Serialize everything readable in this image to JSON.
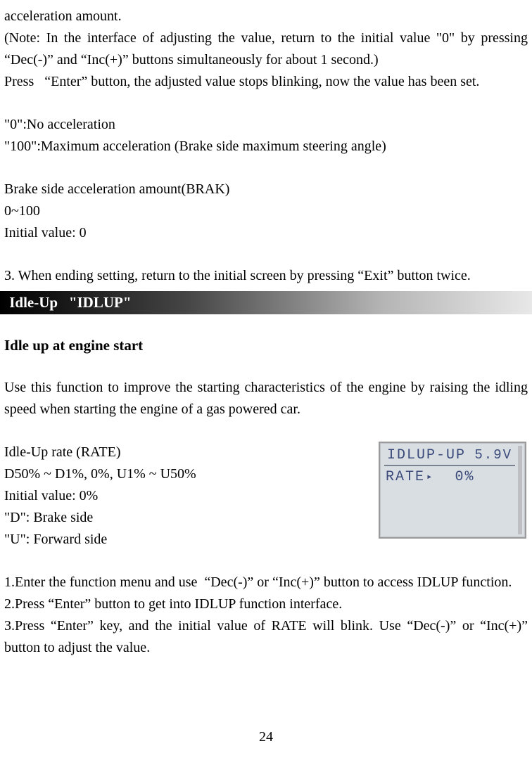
{
  "para1": "acceleration amount.",
  "para2": "(Note: In the interface of adjusting the value, return to the initial value \"0\" by pressing “Dec(-)” and “Inc(+)” buttons simultaneously for about 1 second.)",
  "para3": "Press   “Enter” button, the adjusted value stops blinking, now the value has been set.",
  "para4": "\"0\":No acceleration",
  "para5": "\"100\":Maximum acceleration (Brake side maximum steering angle)",
  "para6": "Brake side acceleration amount(BRAK)",
  "para7": "0~100",
  "para8": "Initial value: 0",
  "para9": "3. When ending setting, return to the initial screen by pressing “Exit” button twice.",
  "banner": " Idle-Up   \"IDLUP\"",
  "subheading": "Idle up at engine start",
  "para10": "Use this function to improve the starting characteristics of the engine by raising the idling speed when starting the engine of a gas powered car.",
  "rate_line1": "Idle-Up rate (RATE)",
  "rate_line2": "D50% ~ D1%, 0%, U1% ~ U50%",
  "rate_line3": "Initial value: 0%",
  "rate_line4": "\"D\": Brake side",
  "rate_line5": "\"U\": Forward side",
  "lcd": {
    "title": "IDLUP-UP",
    "voltage": "5.9V",
    "rate_label": "RATE",
    "marker": "▸",
    "rate_value": "0%"
  },
  "step1": "1.Enter the function menu and use  “Dec(-)” or “Inc(+)” button to access IDLUP function.",
  "step2": "2.Press “Enter” button to get into IDLUP function interface.",
  "step3": "3.Press “Enter” key, and the initial value of RATE will blink. Use “Dec(-)” or “Inc(+)” button to adjust the value.",
  "page_number": "24"
}
